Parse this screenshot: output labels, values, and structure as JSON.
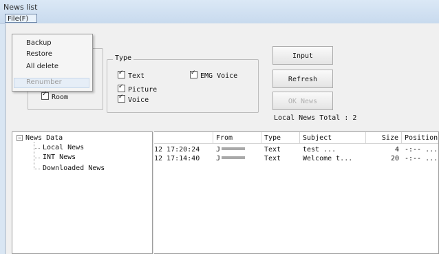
{
  "window": {
    "title": "News list"
  },
  "menu": {
    "file_label": "File(F)",
    "items": [
      {
        "label": "Backup",
        "enabled": true
      },
      {
        "label": "Restore",
        "enabled": true
      },
      {
        "label": "All delete",
        "enabled": true
      },
      {
        "label": "Renumber",
        "enabled": false
      }
    ]
  },
  "filters": {
    "location": {
      "room_label": "Room",
      "room_checked": true
    },
    "type": {
      "legend": "Type",
      "text_label": "Text",
      "text_checked": true,
      "picture_label": "Picture",
      "picture_checked": true,
      "voice_label": "Voice",
      "voice_checked": true,
      "emg_label": "EMG Voice",
      "emg_checked": true
    }
  },
  "buttons": {
    "input": "Input",
    "refresh": "Refresh",
    "ok_news": "OK News"
  },
  "total": "Local News Total : 2",
  "tree": {
    "root": "News Data",
    "toggle": "−",
    "children": [
      "Local News",
      "INT News",
      "Downloaded News"
    ]
  },
  "list": {
    "columns": [
      "",
      "From",
      "Type",
      "Subject",
      "Size",
      "Position"
    ],
    "rows": [
      {
        "date": "12 17:20:24",
        "from": "J",
        "type": "Text",
        "subject": "test      ...",
        "size": "4",
        "position": "-:-- ..."
      },
      {
        "date": "12 17:14:40",
        "from": "J",
        "type": "Text",
        "subject": "Welcome t...",
        "size": "20",
        "position": "-:-- ..."
      }
    ]
  }
}
